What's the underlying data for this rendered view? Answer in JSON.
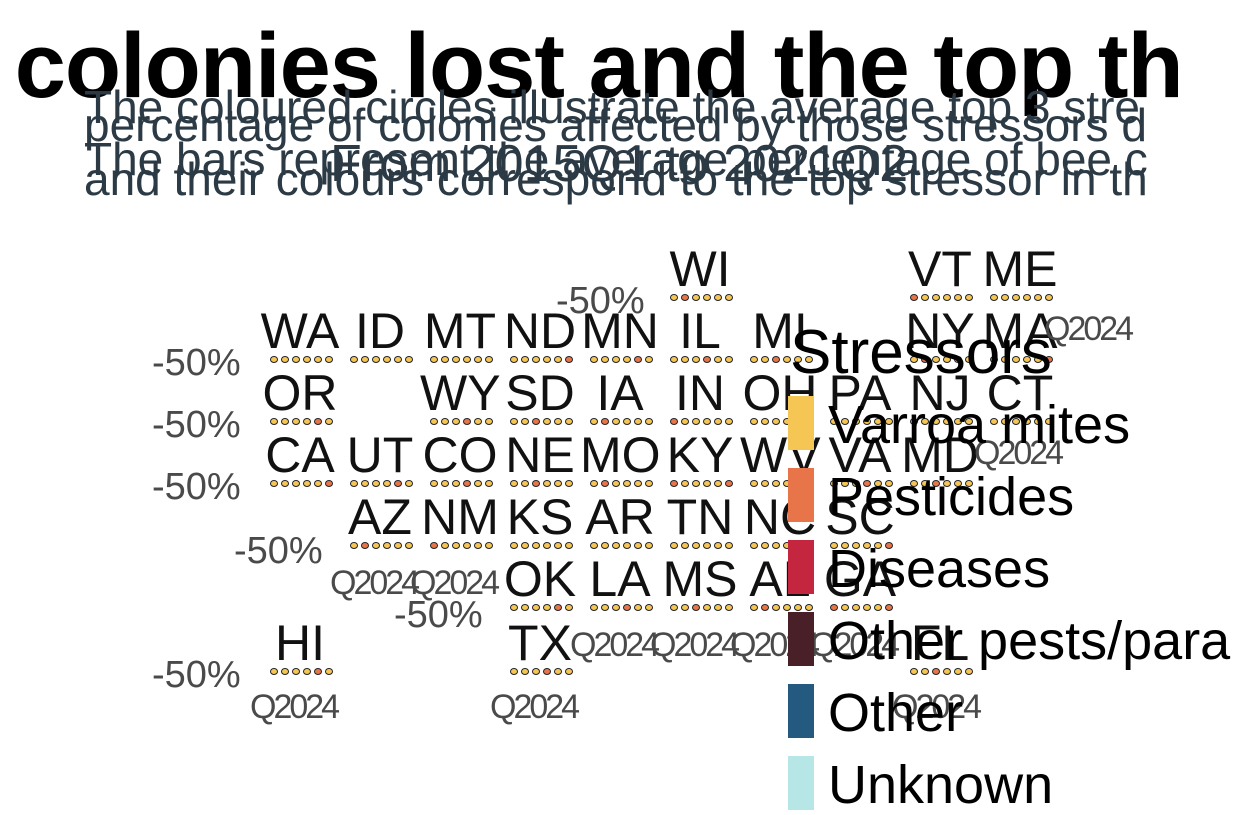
{
  "title": "e colonies lost and the top th",
  "subtitle_lines": [
    "The coloured circles illustrate the average top 3 stre",
    "percentage of colonies affected by those stressors d",
    "The bars represent the average percentage of bee c",
    "and their colours correspond to the top stressor in th"
  ],
  "period": "From 2015Q1 to 2021Q2",
  "chart_data": {
    "type": "tile-map",
    "axis_tick_y": "-50%",
    "axis_tick_x": "Q2024",
    "legend": {
      "title": "Stressors",
      "entries": [
        {
          "label": "Varroa mites",
          "color": "#f6c654"
        },
        {
          "label": "Pesticides",
          "color": "#e8744a"
        },
        {
          "label": "Diseases",
          "color": "#c4253f"
        },
        {
          "label": "Other pests/para",
          "color": "#4a2028"
        },
        {
          "label": "Other",
          "color": "#245a80"
        },
        {
          "label": "Unknown",
          "color": "#b7e6e6"
        }
      ]
    },
    "states": [
      "WI",
      "VT",
      "ME",
      "WA",
      "ID",
      "MT",
      "ND",
      "MN",
      "IL",
      "MI",
      "NY",
      "MA",
      "OR",
      "WY",
      "SD",
      "IA",
      "IN",
      "OH",
      "PA",
      "NJ",
      "CT",
      "CA",
      "UT",
      "CO",
      "NE",
      "MO",
      "KY",
      "WV",
      "VA",
      "MD",
      "AZ",
      "NM",
      "KS",
      "AR",
      "TN",
      "NC",
      "SC",
      "OK",
      "LA",
      "MS",
      "AL",
      "GA",
      "HI",
      "TX",
      "FL"
    ]
  }
}
